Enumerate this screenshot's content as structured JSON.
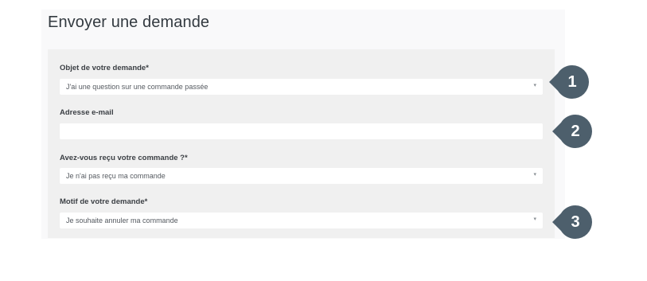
{
  "form_title": "Envoyer une demande",
  "fields": [
    {
      "label": "Objet de votre demande*",
      "value": "J'ai une question sur une commande passée",
      "type": "select"
    },
    {
      "label": "Adresse e-mail",
      "value": "",
      "type": "text"
    },
    {
      "label": "Avez-vous reçu votre commande ?*",
      "value": "Je n'ai pas reçu ma commande",
      "type": "select"
    },
    {
      "label": "Motif de votre demande*",
      "value": "Je souhaite annuler ma commande",
      "type": "select"
    }
  ],
  "dropdown_caret": "▾",
  "markers": [
    "1",
    "2",
    "3"
  ],
  "colors": {
    "marker_fill": "#4d5f6c",
    "form_background": "#f0f0f0",
    "field_background": "#ffffff"
  }
}
